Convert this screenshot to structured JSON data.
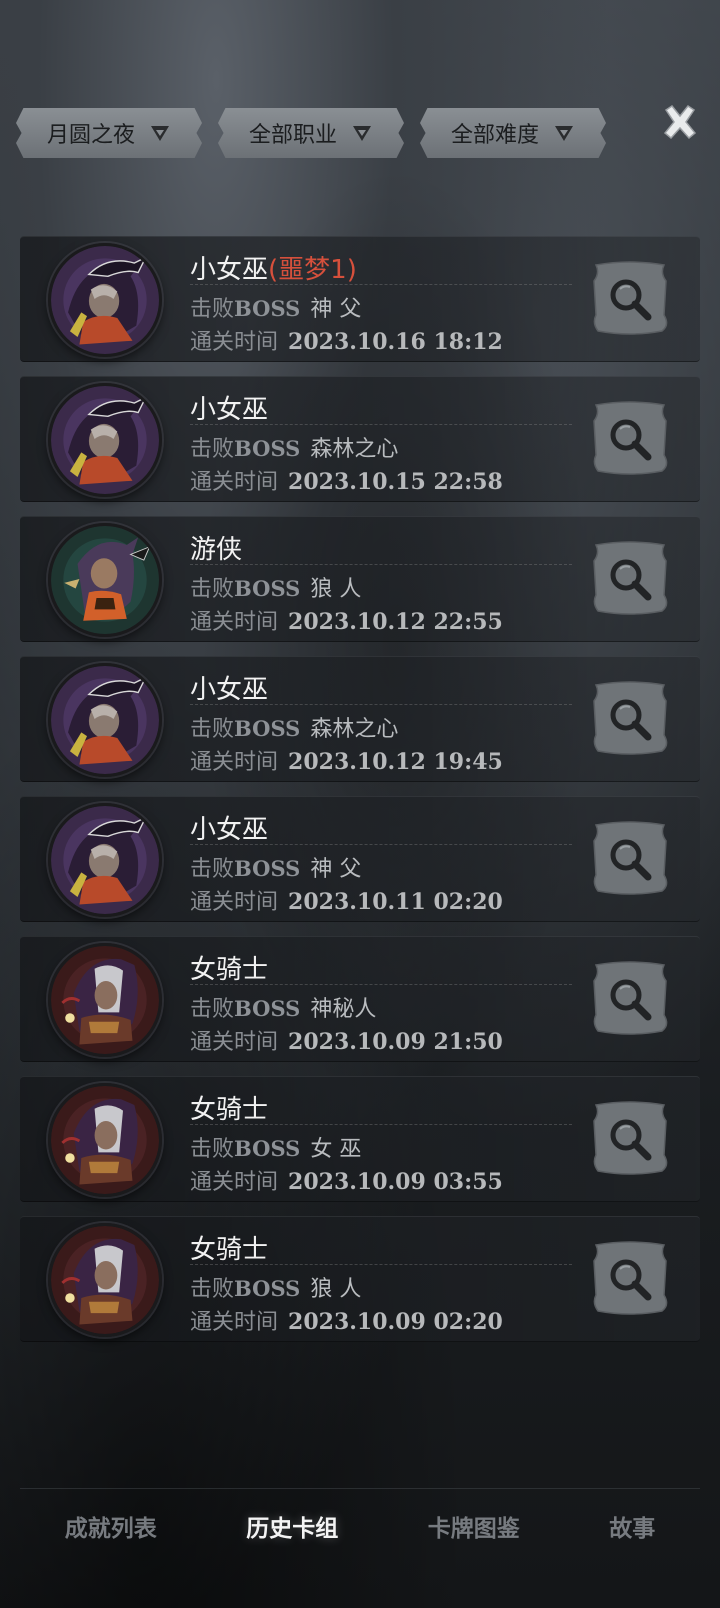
{
  "filters": [
    {
      "label": "月圆之夜"
    },
    {
      "label": "全部职业"
    },
    {
      "label": "全部难度"
    }
  ],
  "close_icon": "close-x-icon",
  "labels": {
    "boss_prefix": "击败",
    "boss_word": "BOSS",
    "time_prefix": "通关时间"
  },
  "records": [
    {
      "hero": "小女巫",
      "difficulty": "(噩梦1)",
      "boss": "神 父",
      "time": "2023.10.16 18:12",
      "portrait": "witch"
    },
    {
      "hero": "小女巫",
      "difficulty": "",
      "boss": "森林之心",
      "time": "2023.10.15 22:58",
      "portrait": "witch"
    },
    {
      "hero": "游侠",
      "difficulty": "",
      "boss": "狼 人",
      "time": "2023.10.12 22:55",
      "portrait": "ranger"
    },
    {
      "hero": "小女巫",
      "difficulty": "",
      "boss": "森林之心",
      "time": "2023.10.12 19:45",
      "portrait": "witch"
    },
    {
      "hero": "小女巫",
      "difficulty": "",
      "boss": "神 父",
      "time": "2023.10.11 02:20",
      "portrait": "witch"
    },
    {
      "hero": "女骑士",
      "difficulty": "",
      "boss": "神秘人",
      "time": "2023.10.09 21:50",
      "portrait": "knight"
    },
    {
      "hero": "女骑士",
      "difficulty": "",
      "boss": "女 巫",
      "time": "2023.10.09 03:55",
      "portrait": "knight"
    },
    {
      "hero": "女骑士",
      "difficulty": "",
      "boss": "狼 人",
      "time": "2023.10.09 02:20",
      "portrait": "knight"
    }
  ],
  "tabs": [
    {
      "label": "成就列表",
      "active": false
    },
    {
      "label": "历史卡组",
      "active": true
    },
    {
      "label": "卡牌图鉴",
      "active": false
    },
    {
      "label": "故事",
      "active": false
    }
  ],
  "colors": {
    "difficulty": "#d6503c",
    "filter_bg": "#7c8186",
    "active_tab": "#f4f4f4",
    "inactive_tab": "#777b80"
  }
}
